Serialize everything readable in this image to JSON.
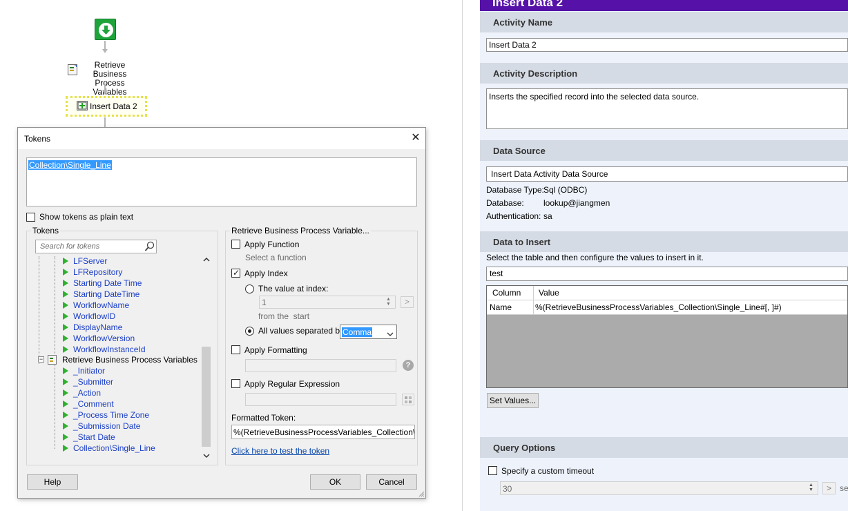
{
  "workflow": {
    "node_retrieve_line1": "Retrieve Business",
    "node_retrieve_line2": "Process Variables",
    "node_insert": "Insert Data 2"
  },
  "tokens_dialog": {
    "title": "Tokens",
    "close_glyph": "✕",
    "token_text": "Collection\\Single_Line",
    "show_plain_label": "Show tokens as plain text",
    "tokens_group_label": "Tokens",
    "search_placeholder": "Search for tokens",
    "tree_items_upper": [
      "LFServer",
      "LFRepository",
      "Starting Date Time",
      "Starting DateTime",
      "WorkflowName",
      "WorkflowID",
      "DisplayName",
      "WorkflowVersion",
      "WorkflowInstanceId"
    ],
    "tree_parent": "Retrieve Business Process Variables",
    "tree_items_lower": [
      "_Initiator",
      "_Submitter",
      "_Action",
      "_Comment",
      "_Process Time Zone",
      "_Submission Date",
      "_Start Date",
      "Collection\\Single_Line"
    ],
    "options_group_label": "Retrieve Business Process Variable...",
    "apply_function_label": "Apply Function",
    "apply_function_checked": false,
    "select_function_text": "Select a function",
    "apply_index_label": "Apply Index",
    "apply_index_checked": true,
    "value_at_index_label": "The value at index:",
    "index_value": "1",
    "from_start_text": "from the  start",
    "all_values_label": "All values separated by:",
    "separator_value": "Comma",
    "apply_formatting_label": "Apply Formatting",
    "apply_regex_label": "Apply Regular Expression",
    "formatted_token_label": "Formatted Token:",
    "formatted_token_value": "%(RetrieveBusinessProcessVariables_Collection\\Single",
    "test_link": "Click here to test the token",
    "help_button": "Help",
    "ok_button": "OK",
    "cancel_button": "Cancel",
    "go_glyph": ">",
    "help_glyph": "?"
  },
  "properties": {
    "title": "Insert Data 2",
    "activity_name_header": "Activity Name",
    "activity_name_value": "Insert Data 2",
    "activity_description_header": "Activity Description",
    "activity_description_value": "Inserts the specified record into the selected data source.",
    "data_source_header": "Data Source",
    "data_source_value": "Insert Data Activity Data Source",
    "database_type_label": "Database Type:",
    "database_type_value": "Sql (ODBC)",
    "database_label": "Database:",
    "database_value": "lookup@jiangmen",
    "authentication_label": "Authentication:",
    "authentication_value": "sa",
    "data_to_insert_header": "Data to Insert",
    "data_to_insert_hint": "Select the table and then configure the values to insert in it.",
    "table_value": "test",
    "grid_headers": [
      "Column",
      "Value"
    ],
    "grid_rows": [
      {
        "column": "Name",
        "value": "%(RetrieveBusinessProcessVariables_Collection\\Single_Line#[, ]#)"
      }
    ],
    "set_values_button": "Set Values...",
    "query_options_header": "Query Options",
    "custom_timeout_label": "Specify a custom timeout",
    "timeout_value": "30",
    "timeout_unit_fragment": "se"
  }
}
